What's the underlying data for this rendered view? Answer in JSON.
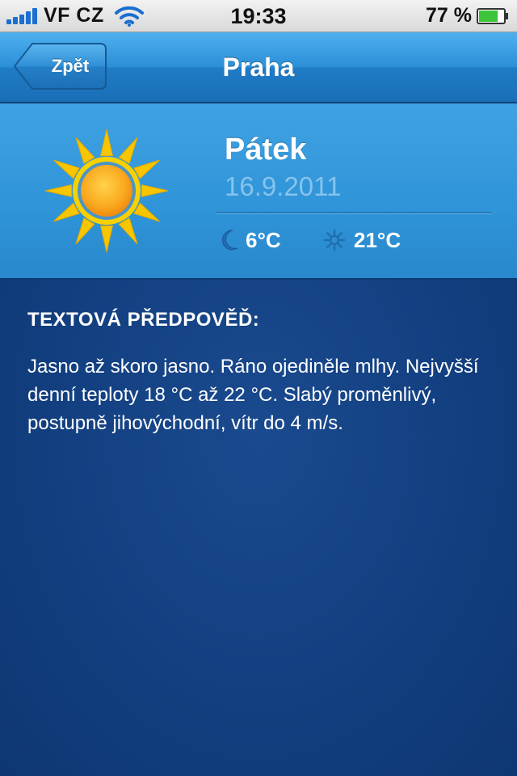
{
  "status_bar": {
    "carrier": "VF CZ",
    "time": "19:33",
    "battery_percent": "77 %",
    "battery_level": 0.77,
    "signal_bars": 5,
    "wifi_icon": "wifi-icon"
  },
  "nav": {
    "back_label": "Zpět",
    "title": "Praha"
  },
  "day": {
    "name": "Pátek",
    "date": "16.9.2011",
    "weather_icon": "sun-icon",
    "night_icon": "moon-icon",
    "night_temp": "6°C",
    "day_icon": "sun-small-icon",
    "day_temp": "21°C"
  },
  "forecast": {
    "heading": "TEXTOVÁ PŘEDPOVĚĎ:",
    "text": "Jasno až skoro jasno. Ráno ojediněle mlhy. Nejvyšší denní teploty 18 °C až 22 °C. Slabý proměnlivý, postupně jihovýchodní, vítr do 4 m/s."
  },
  "colors": {
    "nav_blue": "#2b8fd8",
    "panel_blue": "#3fa2e2",
    "background_navy": "#123f80",
    "date_text": "#86c3ec",
    "sun_yellow": "#f7c600",
    "sun_orange": "#f7a21b"
  }
}
